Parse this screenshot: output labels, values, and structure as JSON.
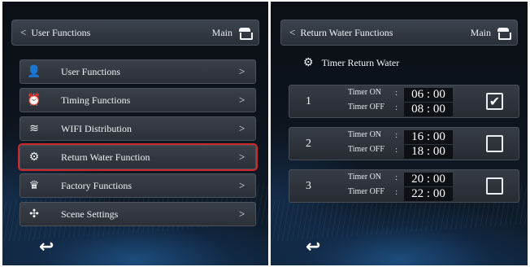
{
  "left_screen": {
    "header": {
      "back_glyph": "<",
      "title": "User Functions",
      "main_label": "Main"
    },
    "menu": [
      {
        "label": "User Functions",
        "icon": "user-icon",
        "glyph": "👤"
      },
      {
        "label": "Timing Functions",
        "icon": "alarm-clock-icon",
        "glyph": "⏰"
      },
      {
        "label": "WIFI Distribution",
        "icon": "wifi-icon",
        "glyph": "≋"
      },
      {
        "label": "Return Water Function",
        "icon": "pump-icon",
        "glyph": "⚙"
      },
      {
        "label": "Factory Functions",
        "icon": "factory-icon",
        "glyph": "♛"
      },
      {
        "label": "Scene Settings",
        "icon": "scene-icon",
        "glyph": "✣"
      }
    ],
    "chevron": ">",
    "selected_index": 3,
    "back_glyph": "↩"
  },
  "right_screen": {
    "header": {
      "back_glyph": "<",
      "title": "Return Water Functions",
      "main_label": "Main"
    },
    "subtitle": "Timer Return Water",
    "subtitle_glyph": "⚙",
    "timer_on_label": "Timer ON",
    "timer_off_label": "Timer OFF",
    "separator": ":",
    "timers": [
      {
        "index": "1",
        "on": "06 : 00",
        "off": "08 : 00",
        "checked": true
      },
      {
        "index": "2",
        "on": "16 : 00",
        "off": "18 : 00",
        "checked": false
      },
      {
        "index": "3",
        "on": "20 : 00",
        "off": "22 : 00",
        "checked": false
      }
    ],
    "back_glyph": "↩"
  },
  "colors": {
    "selection_outline": "#d0262a",
    "panel_bg": "#0d141d"
  }
}
